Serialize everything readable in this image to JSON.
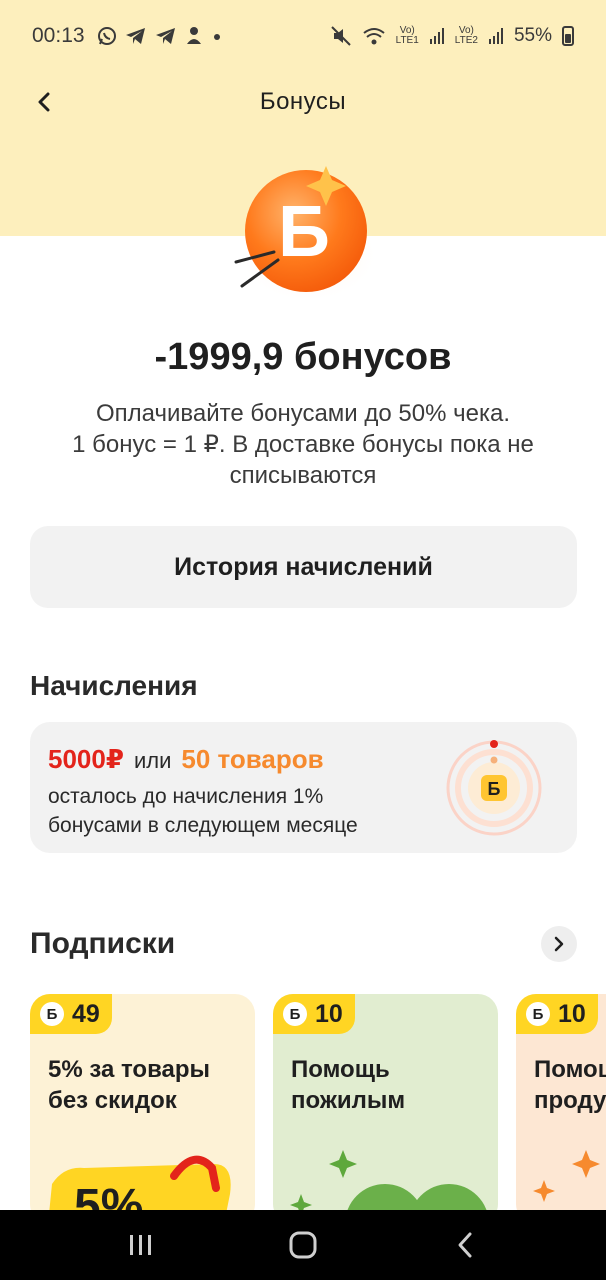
{
  "status_bar": {
    "time": "00:13",
    "lte1": "LTE1",
    "lte2": "LTE2",
    "battery": "55%"
  },
  "header": {
    "title": "Бонусы"
  },
  "coin": {
    "letter": "Б"
  },
  "balance": {
    "amount": "-1999,9 бонусов",
    "desc_line1": "Оплачивайте бонусами до 50% чека.",
    "desc_line2": "1 бонус = 1 ₽. В доставке бонусы пока не",
    "desc_line3": "списываются"
  },
  "history_button": "История начислений",
  "accruals": {
    "title": "Начисления",
    "amount": "5000₽",
    "or": "или",
    "goods": "50 товаров",
    "line2": "осталось до начисления 1%",
    "line3": "бонусами в следующем месяце",
    "badge_letter": "Б"
  },
  "subscriptions": {
    "title": "Подписки",
    "cards": [
      {
        "price": "49",
        "title_line1": "5% за товары",
        "title_line2": "без скидок",
        "bg": "#fdf2d6"
      },
      {
        "price": "10",
        "title_line1": "Помощь",
        "title_line2": "пожилым",
        "bg": "#e1edd0"
      },
      {
        "price": "10",
        "title_line1": "Помощ",
        "title_line2": "проду",
        "bg": "#fde7d3"
      }
    ],
    "tag_letter": "Б",
    "card1_art": "5%"
  },
  "colors": {
    "top_band": "#fdefbd",
    "accent_red": "#e3241b",
    "accent_orange": "#f68a2e",
    "tag_yellow": "#ffd523"
  }
}
